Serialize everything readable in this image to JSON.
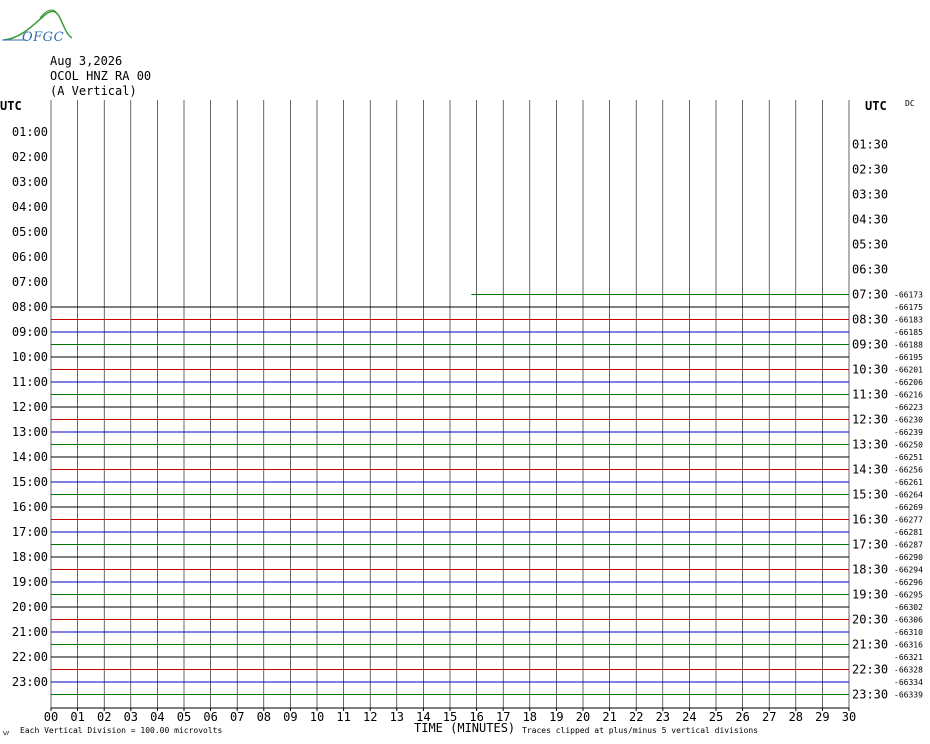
{
  "logo_text": "OFGC",
  "header": {
    "date": "Aug 3,2026",
    "station": "OCOL HNZ RA 00",
    "component": "(A Vertical)"
  },
  "left_axis_title": "UTC",
  "right_axis_title": "UTC",
  "dc_label": "DC",
  "footer": {
    "scale_note": "Each Vertical Division =  100.00 microvolts",
    "x_title": "TIME (MINUTES)",
    "clip_note": "Traces clipped at plus/minus 5 vertical divisions"
  },
  "colors": {
    "grid": "#000000",
    "trace_black": "#000000",
    "trace_red": "#cc0000",
    "trace_blue": "#0000cc",
    "trace_green": "#007700",
    "logo_blue": "#2f6fb6",
    "logo_green": "#3a9a3a"
  },
  "chart_data": {
    "type": "line",
    "description_kind": "helicorder",
    "x_ticks": [
      "00",
      "01",
      "02",
      "03",
      "04",
      "05",
      "06",
      "07",
      "08",
      "09",
      "10",
      "11",
      "12",
      "13",
      "14",
      "15",
      "16",
      "17",
      "18",
      "19",
      "20",
      "21",
      "22",
      "23",
      "24",
      "25",
      "26",
      "27",
      "28",
      "29",
      "30"
    ],
    "xlim": [
      0,
      30
    ],
    "left_labels": [
      "01:00",
      "02:00",
      "03:00",
      "04:00",
      "05:00",
      "06:00",
      "07:00",
      "08:00",
      "09:00",
      "10:00",
      "11:00",
      "12:00",
      "13:00",
      "14:00",
      "15:00",
      "16:00",
      "17:00",
      "18:00",
      "19:00",
      "20:00",
      "21:00",
      "22:00",
      "23:00"
    ],
    "right_labels": [
      "01:30",
      "02:30",
      "03:30",
      "04:30",
      "05:30",
      "06:30",
      "07:30",
      "08:30",
      "09:30",
      "10:30",
      "11:30",
      "12:30",
      "13:30",
      "14:30",
      "15:30",
      "16:30",
      "17:30",
      "18:30",
      "19:30",
      "20:30",
      "21:30",
      "22:30",
      "23:30"
    ],
    "trace_color_cycle": [
      "black",
      "red",
      "blue",
      "green"
    ],
    "traces": [
      {
        "row_time": "07:30",
        "start_minute": 15.8,
        "dc": "-66173",
        "color": "green"
      },
      {
        "row_time": "08:00",
        "start_minute": 0,
        "dc": "-66175",
        "color": "black"
      },
      {
        "row_time": "08:30",
        "start_minute": 0,
        "dc": "-66183",
        "color": "red"
      },
      {
        "row_time": "09:00",
        "start_minute": 0,
        "dc": "-66185",
        "color": "blue"
      },
      {
        "row_time": "09:30",
        "start_minute": 0,
        "dc": "-66188",
        "color": "green"
      },
      {
        "row_time": "10:00",
        "start_minute": 0,
        "dc": "-66195",
        "color": "black"
      },
      {
        "row_time": "10:30",
        "start_minute": 0,
        "dc": "-66201",
        "color": "red"
      },
      {
        "row_time": "11:00",
        "start_minute": 0,
        "dc": "-66206",
        "color": "blue"
      },
      {
        "row_time": "11:30",
        "start_minute": 0,
        "dc": "-66216",
        "color": "green"
      },
      {
        "row_time": "12:00",
        "start_minute": 0,
        "dc": "-66223",
        "color": "black"
      },
      {
        "row_time": "12:30",
        "start_minute": 0,
        "dc": "-66230",
        "color": "red"
      },
      {
        "row_time": "13:00",
        "start_minute": 0,
        "dc": "-66239",
        "color": "blue"
      },
      {
        "row_time": "13:30",
        "start_minute": 0,
        "dc": "-66250",
        "color": "green"
      },
      {
        "row_time": "14:00",
        "start_minute": 0,
        "dc": "-66251",
        "color": "black"
      },
      {
        "row_time": "14:30",
        "start_minute": 0,
        "dc": "-66256",
        "color": "red"
      },
      {
        "row_time": "15:00",
        "start_minute": 0,
        "dc": "-66261",
        "color": "blue"
      },
      {
        "row_time": "15:30",
        "start_minute": 0,
        "dc": "-66264",
        "color": "green"
      },
      {
        "row_time": "16:00",
        "start_minute": 0,
        "dc": "-66269",
        "color": "black"
      },
      {
        "row_time": "16:30",
        "start_minute": 0,
        "dc": "-66277",
        "color": "red"
      },
      {
        "row_time": "17:00",
        "start_minute": 0,
        "dc": "-66281",
        "color": "blue"
      },
      {
        "row_time": "17:30",
        "start_minute": 0,
        "dc": "-66287",
        "color": "green"
      },
      {
        "row_time": "18:00",
        "start_minute": 0,
        "dc": "-66290",
        "color": "black"
      },
      {
        "row_time": "18:30",
        "start_minute": 0,
        "dc": "-66294",
        "color": "red"
      },
      {
        "row_time": "19:00",
        "start_minute": 0,
        "dc": "-66296",
        "color": "blue"
      },
      {
        "row_time": "19:30",
        "start_minute": 0,
        "dc": "-66295",
        "color": "green"
      },
      {
        "row_time": "20:00",
        "start_minute": 0,
        "dc": "-66302",
        "color": "black"
      },
      {
        "row_time": "20:30",
        "start_minute": 0,
        "dc": "-66306",
        "color": "red"
      },
      {
        "row_time": "21:00",
        "start_minute": 0,
        "dc": "-66310",
        "color": "blue"
      },
      {
        "row_time": "21:30",
        "start_minute": 0,
        "dc": "-66316",
        "color": "green"
      },
      {
        "row_time": "22:00",
        "start_minute": 0,
        "dc": "-66321",
        "color": "black"
      },
      {
        "row_time": "22:30",
        "start_minute": 0,
        "dc": "-66328",
        "color": "red"
      },
      {
        "row_time": "23:00",
        "start_minute": 0,
        "dc": "-66334",
        "color": "blue"
      },
      {
        "row_time": "23:30",
        "start_minute": 0,
        "dc": "-66339",
        "color": "green"
      }
    ]
  }
}
